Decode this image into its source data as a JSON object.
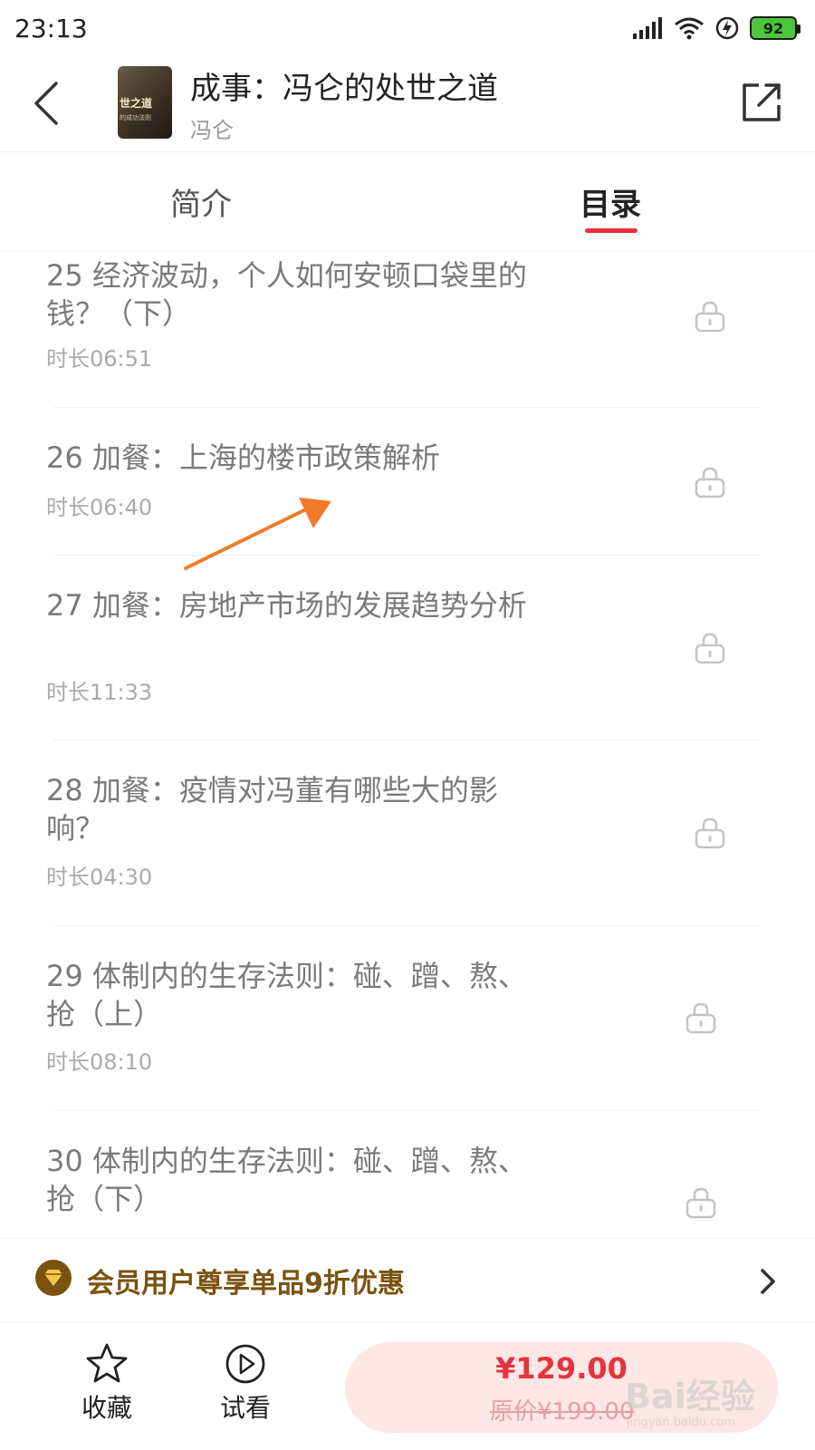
{
  "status_bar": {
    "time": "23:13",
    "battery": "92"
  },
  "header": {
    "book_title": "成事：冯仑的处世之道",
    "author": "冯仑",
    "cover": {
      "title_text": "世之道",
      "sub_text": "的成功法则"
    }
  },
  "tabs": [
    {
      "label": "简介",
      "active": false
    },
    {
      "label": "目录",
      "active": true
    }
  ],
  "catalog": {
    "items": [
      {
        "title": "25 经济波动，个人如何安顿口袋里的钱？（下）",
        "duration": "时长06:51",
        "locked": true
      },
      {
        "title": "26 加餐：上海的楼市政策解析",
        "duration": "时长06:40",
        "locked": true
      },
      {
        "title": "27 加餐：房地产市场的发展趋势分析",
        "duration": "时长11:33",
        "locked": true
      },
      {
        "title": "28 加餐：疫情对冯董有哪些大的影响？",
        "duration": "时长04:30",
        "locked": true
      },
      {
        "title": "29 体制内的生存法则：碰、蹭、熬、抢（上）",
        "duration": "时长08:10",
        "locked": true
      },
      {
        "title": "30 体制内的生存法则：碰、蹭、熬、抢（下）",
        "duration": "",
        "locked": true
      }
    ]
  },
  "promo": {
    "text": "会员用户尊享单品9折优惠"
  },
  "bottom_bar": {
    "collect_label": "收藏",
    "preview_label": "试看",
    "price": "¥129.00",
    "original_price": "原价¥199.00"
  },
  "watermark": {
    "brand": "Bai经验",
    "url": "jingyan.baidu.com"
  },
  "colors": {
    "accent": "#e8303a",
    "price": "#e6333c",
    "buy_bg": "#fde6e6",
    "promo_text": "#7a5310",
    "annotation_arrow": "#f07a2a"
  }
}
